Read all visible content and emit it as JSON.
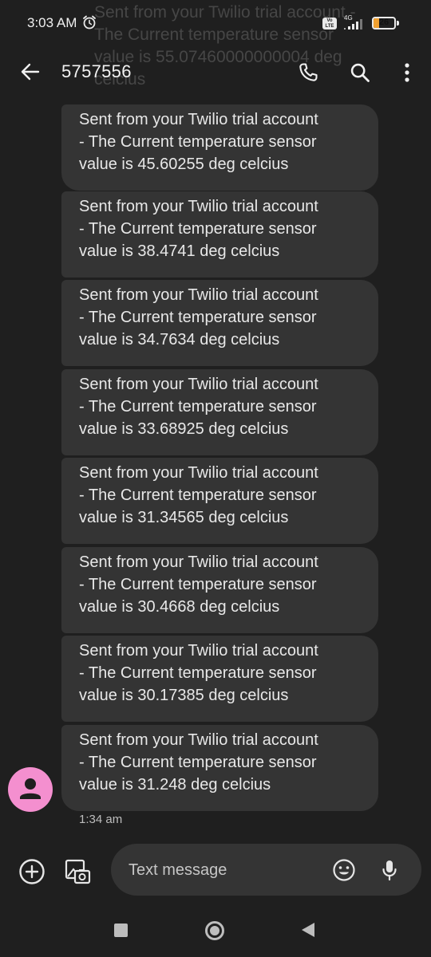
{
  "status_bar": {
    "time": "3:03 AM",
    "network": "4G",
    "volte": "Vo LTE",
    "battery_percent": "26",
    "battery_level": 0.26,
    "icons": [
      "alarm-icon",
      "volte-icon",
      "signal-icon",
      "battery-icon"
    ]
  },
  "notification_ghost": "Sent from your Twilio trial account - The Current temperature sensor value is 55.07460000000004 deg celcius",
  "app_bar": {
    "contact": "5757556",
    "icons": [
      "back-arrow-icon",
      "phone-icon",
      "search-icon",
      "more-vert-icon"
    ]
  },
  "messages": [
    {
      "line1": "Sent from your Twilio trial account",
      "line2": "- The Current temperature sensor",
      "line3": "value is 45.60255 deg celcius"
    },
    {
      "line1": "Sent from your Twilio trial account",
      "line2": "- The Current temperature sensor",
      "line3": "value is 38.4741 deg celcius"
    },
    {
      "line1": "Sent from your Twilio trial account",
      "line2": "- The Current temperature sensor",
      "line3": "value is 34.7634 deg celcius"
    },
    {
      "line1": "Sent from your Twilio trial account",
      "line2": "- The Current temperature sensor",
      "line3": "value is 33.68925 deg celcius"
    },
    {
      "line1": "Sent from your Twilio trial account",
      "line2": "- The Current temperature sensor",
      "line3": "value is 31.34565 deg celcius"
    },
    {
      "line1": "Sent from your Twilio trial account",
      "line2": "- The Current temperature sensor",
      "line3": "value is 30.4668 deg celcius"
    },
    {
      "line1": "Sent from your Twilio trial account",
      "line2": "- The Current temperature sensor",
      "line3": "value is 30.17385 deg celcius"
    },
    {
      "line1": "Sent from your Twilio trial account",
      "line2": "- The Current temperature sensor",
      "line3": "value is 31.248 deg celcius"
    }
  ],
  "last_message_time": "1:34 am",
  "composer": {
    "placeholder": "Text message",
    "icons": [
      "add-circle-icon",
      "gallery-icon",
      "emoji-icon",
      "mic-icon"
    ]
  },
  "colors": {
    "background": "#1f1f1f",
    "bubble": "#343434",
    "avatar": "#f48fcf",
    "battery_fill": "#f0a030"
  }
}
